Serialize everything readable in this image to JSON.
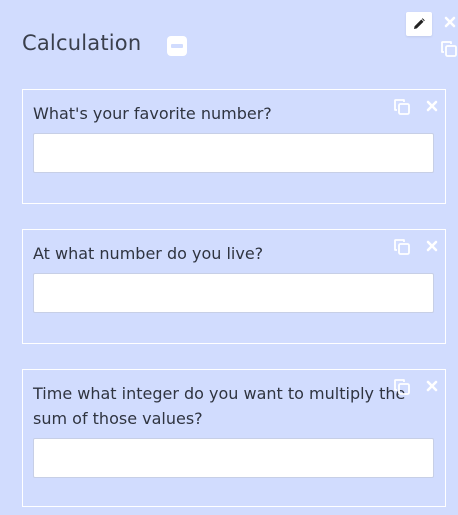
{
  "header": {
    "title": "Calculation"
  },
  "icons": {
    "edit": "pencil-icon",
    "collapse": "minus-icon",
    "copy": "copy-icon",
    "close": "close-icon"
  },
  "colors": {
    "background": "#d1dcfe",
    "card_border": "#ffffff",
    "icon": "#ffffff"
  },
  "questions": [
    {
      "label": "What's your favorite number?",
      "value": "",
      "placeholder": ""
    },
    {
      "label": "At what number do you live?",
      "value": "",
      "placeholder": ""
    },
    {
      "label": "Time what integer do you want to multiply the sum of those values?",
      "value": "",
      "placeholder": ""
    }
  ]
}
